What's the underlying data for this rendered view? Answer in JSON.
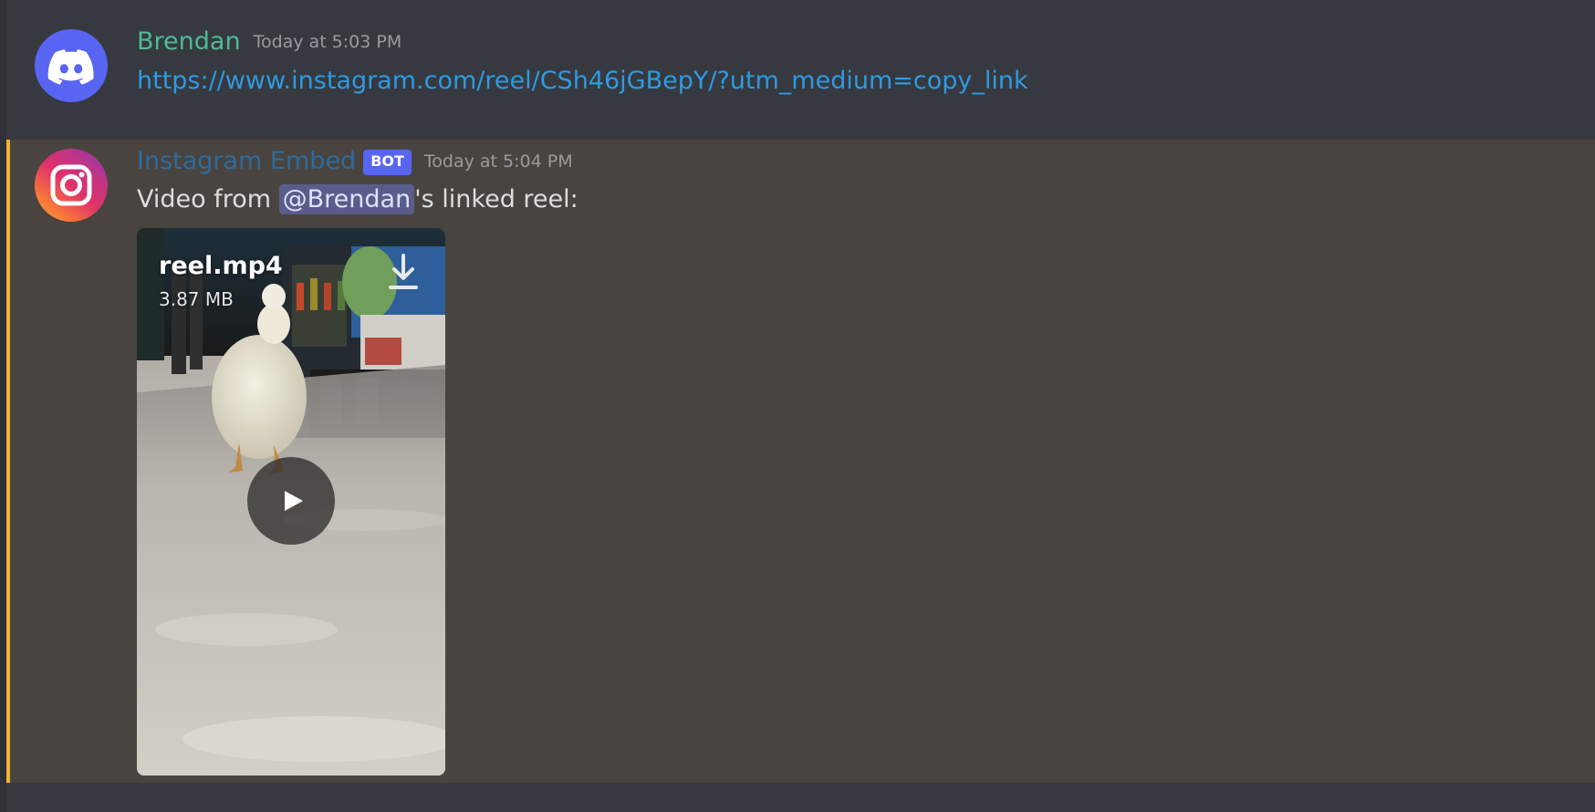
{
  "messages": [
    {
      "author": "Brendan",
      "timestamp": "Today at 5:03 PM",
      "avatar_icon": "discord-logo-icon",
      "link": "https://www.instagram.com/reel/CSh46jGBepY/?utm_medium=copy_link"
    },
    {
      "author": "Instagram Embed",
      "bot_tag": "BOT",
      "timestamp": "Today at 5:04 PM",
      "avatar_icon": "instagram-logo-icon",
      "text_before": "Video from ",
      "mention": "@Brendan",
      "text_after": "'s linked reel:",
      "attachment": {
        "file_name": "reel.mp4",
        "file_size": "3.87 MB",
        "download_icon": "download-icon",
        "play_icon": "play-icon"
      }
    }
  ],
  "colors": {
    "background": "#36393f",
    "highlighted_message": "#49443f",
    "highlight_bar": "#f0b232",
    "link": "#2e9ae0",
    "brendan_name": "#4fba95",
    "bot_tag": "#5865f2"
  }
}
